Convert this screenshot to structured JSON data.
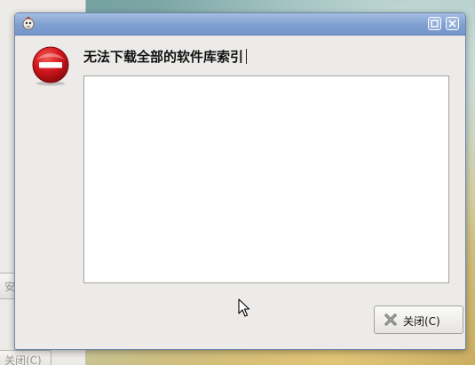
{
  "background_window": {
    "button_1_label": "安",
    "button_2_label": "关闭(C)"
  },
  "dialog": {
    "title": "",
    "heading": "无法下载全部的软件库索引",
    "details_text": "",
    "close_button_label": "关闭(C)"
  },
  "icons": {
    "app": "app-icon",
    "error": "error-icon",
    "maximize": "maximize-icon",
    "close": "close-icon",
    "button_close": "x-icon",
    "cursor": "mouse-cursor"
  },
  "colors": {
    "titlebar": "#7f9fd0",
    "error_red": "#d0151b",
    "dialog_bg": "#edebe9"
  }
}
